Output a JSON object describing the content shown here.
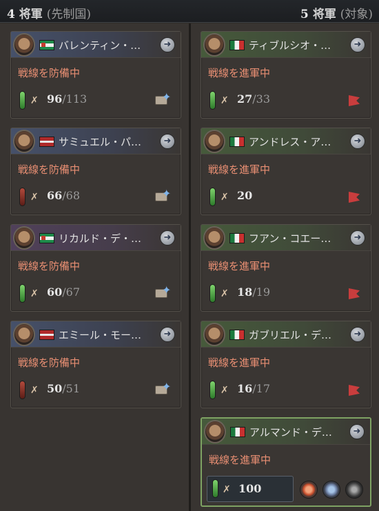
{
  "header": {
    "left": {
      "count": "4",
      "label": "将軍",
      "side": "(先制国)"
    },
    "right": {
      "count": "5",
      "label": "将軍",
      "side": "(対象)"
    }
  },
  "left_generals": [
    {
      "name": "バレンティン・…",
      "status": "戦線を防備中",
      "current": "96",
      "max": "/113",
      "flag": "green-flag",
      "readiness": "green"
    },
    {
      "name": "サミュエル・パ…",
      "status": "戦線を防備中",
      "current": "66",
      "max": "/68",
      "flag": "red-flag",
      "readiness": "red"
    },
    {
      "name": "リカルド・デ・…",
      "status": "戦線を防備中",
      "current": "60",
      "max": "/67",
      "flag": "green-flag",
      "readiness": "green"
    },
    {
      "name": "エミール・モー…",
      "status": "戦線を防備中",
      "current": "50",
      "max": "/51",
      "flag": "red-flag",
      "readiness": "red"
    }
  ],
  "right_generals": [
    {
      "name": "ティブルシオ・…",
      "status": "戦線を進軍中",
      "current": "27",
      "max": "/33",
      "flag": "mexico-flag",
      "readiness": "green"
    },
    {
      "name": "アンドレス・ア…",
      "status": "戦線を進軍中",
      "current": "20",
      "max": "",
      "flag": "mexico-flag",
      "readiness": "green"
    },
    {
      "name": "フアン・コエー…",
      "status": "戦線を進軍中",
      "current": "18",
      "max": "/19",
      "flag": "mexico-flag",
      "readiness": "green"
    },
    {
      "name": "ガブリエル・デ…",
      "status": "戦線を進軍中",
      "current": "16",
      "max": "/17",
      "flag": "mexico-flag",
      "readiness": "green"
    },
    {
      "name": "アルマンド・デ…",
      "status": "戦線を進軍中",
      "current": "100",
      "max": "",
      "flag": "mexico-flag",
      "readiness": "green",
      "selected": true
    }
  ],
  "icons": {
    "arrow": "arrow-right-icon",
    "infantry": "infantry-icon",
    "defend": "defend-shield-icon",
    "advance": "advance-flag-icon"
  }
}
